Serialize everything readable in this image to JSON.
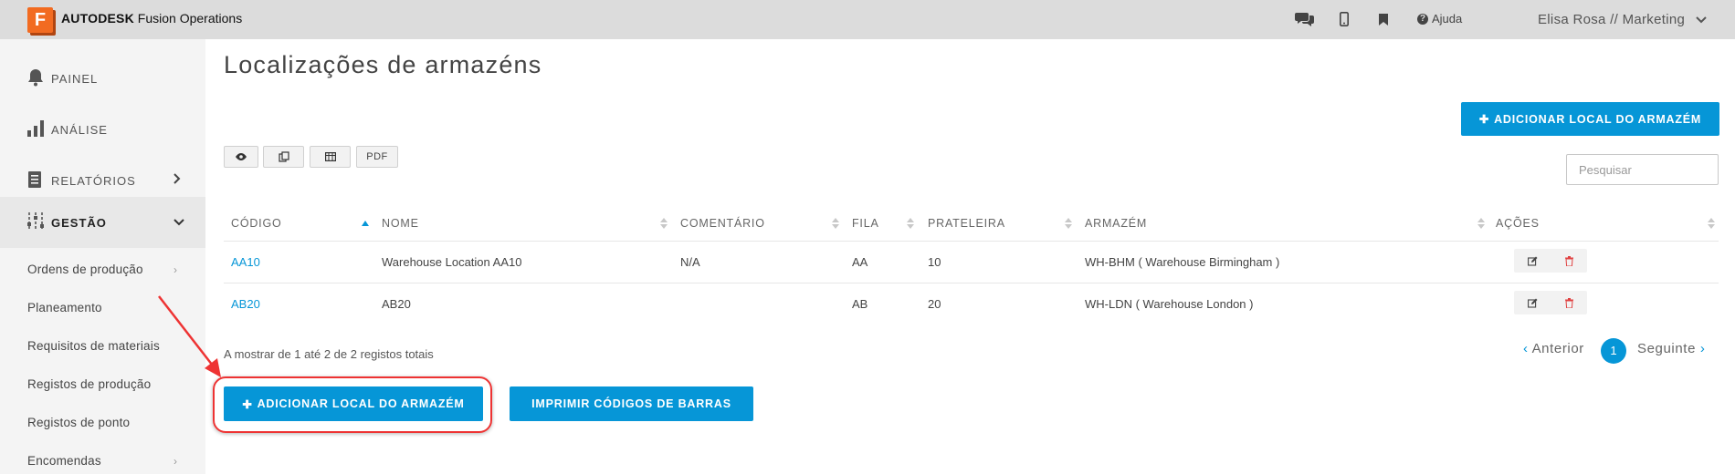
{
  "app": {
    "logo_letter": "F",
    "brand_bold": "AUTODESK",
    "brand_rest": " Fusion Operations",
    "help_label": "Ajuda",
    "user_label": "Elisa Rosa // Marketing"
  },
  "sidebar": {
    "painel": "PAINEL",
    "analise": "ANÁLISE",
    "relatorios": "RELATÓRIOS",
    "gestao": "GESTÃO",
    "sub": [
      "Ordens de produção",
      "Planeamento",
      "Requisitos de materiais",
      "Registos de produção",
      "Registos de ponto",
      "Encomendas"
    ]
  },
  "main": {
    "title": "Localizações de armazéns",
    "add_top": "ADICIONAR LOCAL DO ARMAZÉM",
    "pdf": "PDF",
    "search_placeholder": "Pesquisar",
    "headers": [
      "CÓDIGO",
      "NOME",
      "COMENTÁRIO",
      "FILA",
      "PRATELEIRA",
      "ARMAZÉM",
      "AÇÕES"
    ],
    "rows": [
      {
        "codigo": "AA10",
        "nome": "Warehouse Location AA10",
        "comentario": "N/A",
        "fila": "AA",
        "prateleira": "10",
        "armazem": "WH-BHM ( Warehouse Birmingham )"
      },
      {
        "codigo": "AB20",
        "nome": "AB20",
        "comentario": "",
        "fila": "AB",
        "prateleira": "20",
        "armazem": "WH-LDN ( Warehouse London )"
      }
    ],
    "info": "A mostrar de 1 até 2 de 2 registos totais",
    "prev": "Anterior",
    "page": "1",
    "next": "Seguinte",
    "add_bottom": "ADICIONAR LOCAL DO ARMAZÉM",
    "print_barcodes": "IMPRIMIR CÓDIGOS DE BARRAS"
  },
  "colors": {
    "accent": "#0696d7",
    "logo": "#f26b21",
    "annotation": "#ee3333"
  }
}
